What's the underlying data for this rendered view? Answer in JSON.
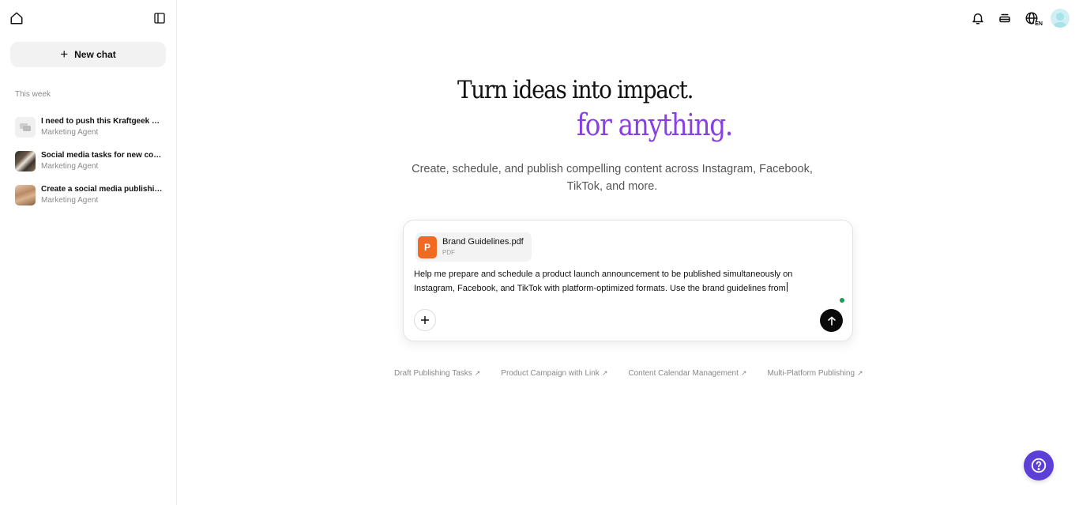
{
  "sidebar": {
    "new_chat_label": "New chat",
    "section_label": "This week",
    "chats": [
      {
        "title": "I need to push this Kraftgeek se...",
        "subtitle": "Marketing Agent",
        "thumb": "chat-bubble-icon"
      },
      {
        "title": "Social media tasks for new coff...",
        "subtitle": "Marketing Agent",
        "thumb": "coffee-photo"
      },
      {
        "title": "Create a social media publishin...",
        "subtitle": "Marketing Agent",
        "thumb": "portrait-photo"
      }
    ]
  },
  "topbar": {
    "icons": [
      "bell-icon",
      "stack-icon",
      "globe-icon",
      "avatar"
    ],
    "language": "EN"
  },
  "hero": {
    "line1": "Turn ideas into impact.",
    "line2": "for anything.",
    "accent_color": "#8a3fe6",
    "subtitle": "Create, schedule, and publish compelling content across Instagram, Facebook, TikTok, and more."
  },
  "composer": {
    "attachment": {
      "icon_letter": "P",
      "name": "Brand Guidelines.pdf",
      "type": "PDF",
      "color": "#f26a22"
    },
    "prompt": "Help me prepare and schedule a product launch announcement to be published simultaneously on Instagram, Facebook, and TikTok with platform-optimized formats. Use the brand guidelines from"
  },
  "suggestions": [
    {
      "label": "Draft Publishing Tasks",
      "arrow": "↗"
    },
    {
      "label": "Product Campaign with Link",
      "arrow": "↗"
    },
    {
      "label": "Content Calendar Management",
      "arrow": "↗"
    },
    {
      "label": "Multi-Platform Publishing",
      "arrow": "↗"
    }
  ],
  "help": {
    "color": "#5b3fd6"
  }
}
